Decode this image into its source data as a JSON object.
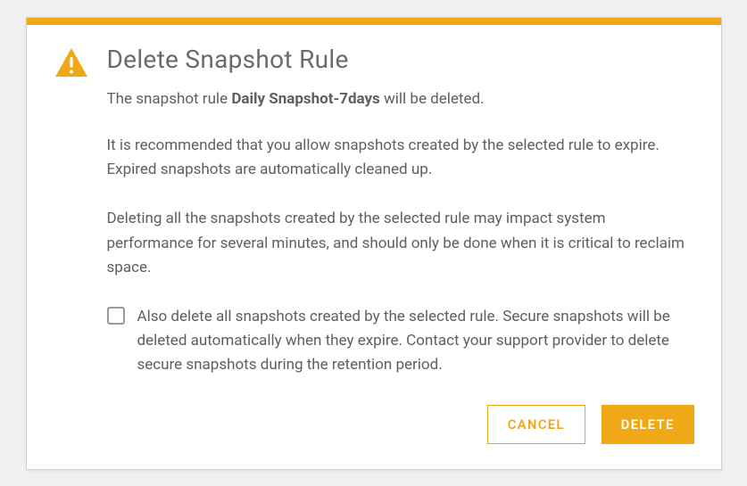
{
  "dialog": {
    "title": "Delete Snapshot Rule",
    "message": {
      "prefix": "The snapshot rule ",
      "rule_name": "Daily Snapshot-7days",
      "suffix": " will be deleted."
    },
    "recommendation": "It is recommended that you allow snapshots created by the selected rule to expire. Expired snapshots are automatically cleaned up.",
    "warning": "Deleting all the snapshots created by the selected rule may impact system performance for several minutes, and should only be done when it is critical to reclaim space.",
    "checkbox": {
      "checked": false,
      "label": "Also delete all snapshots created by the selected rule. Secure snapshots will be deleted automatically when they expire. Contact your support provider to delete secure snapshots during the retention period."
    },
    "buttons": {
      "cancel": "CANCEL",
      "delete": "DELETE"
    }
  },
  "colors": {
    "accent": "#f0a817"
  }
}
